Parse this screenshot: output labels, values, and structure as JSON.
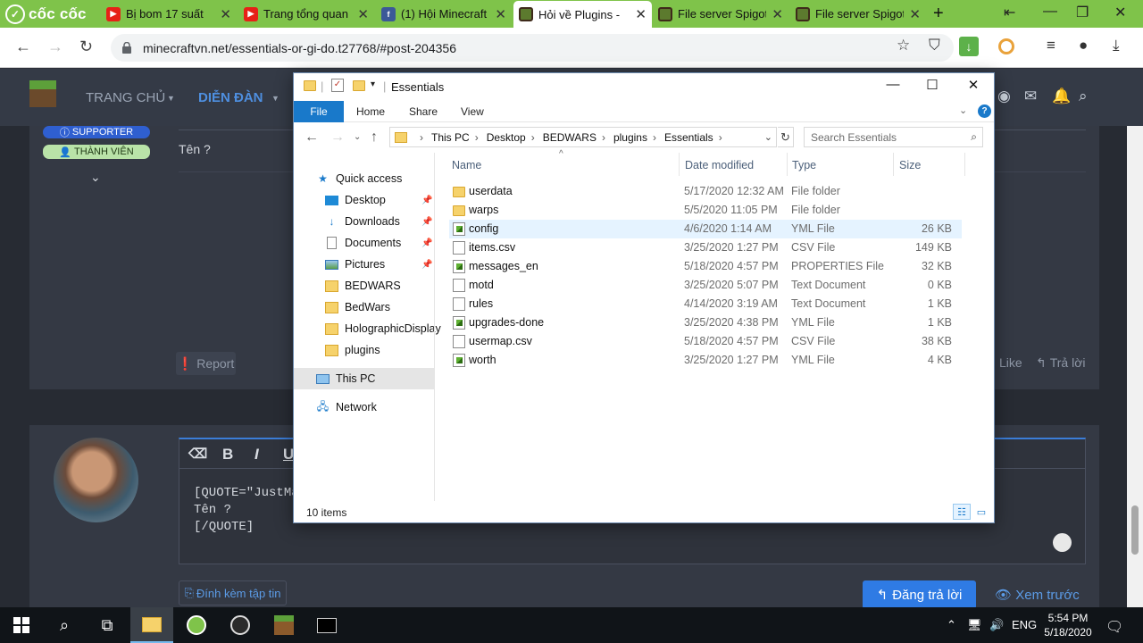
{
  "browser": {
    "brand": "cốc cốc",
    "tabs": [
      {
        "title": "Bị bom 17 suất",
        "icon": "youtube-icon"
      },
      {
        "title": "Trang tổng quan",
        "icon": "youtube-icon"
      },
      {
        "title": "(1) Hội Minecraft",
        "icon": "facebook-icon"
      },
      {
        "title": "Hỏi về Plugins -",
        "icon": "minecraft-icon",
        "active": true
      },
      {
        "title": "File server Spigot",
        "icon": "minecraft-icon"
      },
      {
        "title": "File server Spigot",
        "icon": "minecraft-icon"
      }
    ],
    "new_tab": "+",
    "url": "minecraftvn.net/essentials-or-gi-do.t27768/#post-204356"
  },
  "forum": {
    "nav": {
      "home": "TRANG CHỦ",
      "forums": "DIỄN ĐÀN"
    },
    "badges": {
      "supporter": "SUPPORTER",
      "member": "THÀNH VIÊN"
    },
    "post_text": "Tên ?",
    "report": "Report",
    "like": "Like",
    "reply": "Trả lời",
    "editor_lines": [
      "[QUOTE=\"JustMan",
      "Tên ?",
      "[/QUOTE]"
    ],
    "toolbar": {
      "bold": "B",
      "italic": "I",
      "underline": "U"
    },
    "attach": "Đính kèm tập tin",
    "post_reply": "Đăng trả lời",
    "preview": "Xem trước"
  },
  "explorer": {
    "title": "Essentials",
    "ribbon_tabs": [
      "File",
      "Home",
      "Share",
      "View"
    ],
    "breadcrumb": [
      "This PC",
      "Desktop",
      "BEDWARS",
      "plugins",
      "Essentials"
    ],
    "search_placeholder": "Search Essentials",
    "nav_pane": [
      {
        "label": "Quick access",
        "icon": "star-icon",
        "pinned": false
      },
      {
        "label": "Desktop",
        "icon": "desktop-icon",
        "pinned": true
      },
      {
        "label": "Downloads",
        "icon": "download-icon",
        "pinned": true
      },
      {
        "label": "Documents",
        "icon": "documents-icon",
        "pinned": true
      },
      {
        "label": "Pictures",
        "icon": "pictures-icon",
        "pinned": true
      },
      {
        "label": "BEDWARS",
        "icon": "folder-icon",
        "pinned": false
      },
      {
        "label": "BedWars",
        "icon": "folder-icon",
        "pinned": false
      },
      {
        "label": "HolographicDisplay",
        "icon": "folder-icon",
        "pinned": false
      },
      {
        "label": "plugins",
        "icon": "folder-icon",
        "pinned": false
      },
      {
        "label": "This PC",
        "icon": "computer-icon",
        "pinned": false,
        "selected": true
      },
      {
        "label": "Network",
        "icon": "network-icon",
        "pinned": false
      }
    ],
    "columns": [
      "Name",
      "Date modified",
      "Type",
      "Size"
    ],
    "files": [
      {
        "name": "userdata",
        "date": "5/17/2020 12:32 AM",
        "type": "File folder",
        "size": "",
        "icon": "folder-icon"
      },
      {
        "name": "warps",
        "date": "5/5/2020 11:05 PM",
        "type": "File folder",
        "size": "",
        "icon": "folder-icon"
      },
      {
        "name": "config",
        "date": "4/6/2020 1:14 AM",
        "type": "YML File",
        "size": "26 KB",
        "icon": "yml-file-icon",
        "selected": true
      },
      {
        "name": "items.csv",
        "date": "3/25/2020 1:27 PM",
        "type": "CSV File",
        "size": "149 KB",
        "icon": "text-file-icon"
      },
      {
        "name": "messages_en",
        "date": "5/18/2020 4:57 PM",
        "type": "PROPERTIES File",
        "size": "32 KB",
        "icon": "yml-file-icon"
      },
      {
        "name": "motd",
        "date": "3/25/2020 5:07 PM",
        "type": "Text Document",
        "size": "0 KB",
        "icon": "text-file-icon"
      },
      {
        "name": "rules",
        "date": "4/14/2020 3:19 AM",
        "type": "Text Document",
        "size": "1 KB",
        "icon": "text-file-icon"
      },
      {
        "name": "upgrades-done",
        "date": "3/25/2020 4:38 PM",
        "type": "YML File",
        "size": "1 KB",
        "icon": "yml-file-icon"
      },
      {
        "name": "usermap.csv",
        "date": "5/18/2020 4:57 PM",
        "type": "CSV File",
        "size": "38 KB",
        "icon": "text-file-icon"
      },
      {
        "name": "worth",
        "date": "3/25/2020 1:27 PM",
        "type": "YML File",
        "size": "4 KB",
        "icon": "yml-file-icon"
      }
    ],
    "status": "10 items"
  },
  "taskbar": {
    "lang": "ENG",
    "time": "5:54 PM",
    "date": "5/18/2020"
  }
}
